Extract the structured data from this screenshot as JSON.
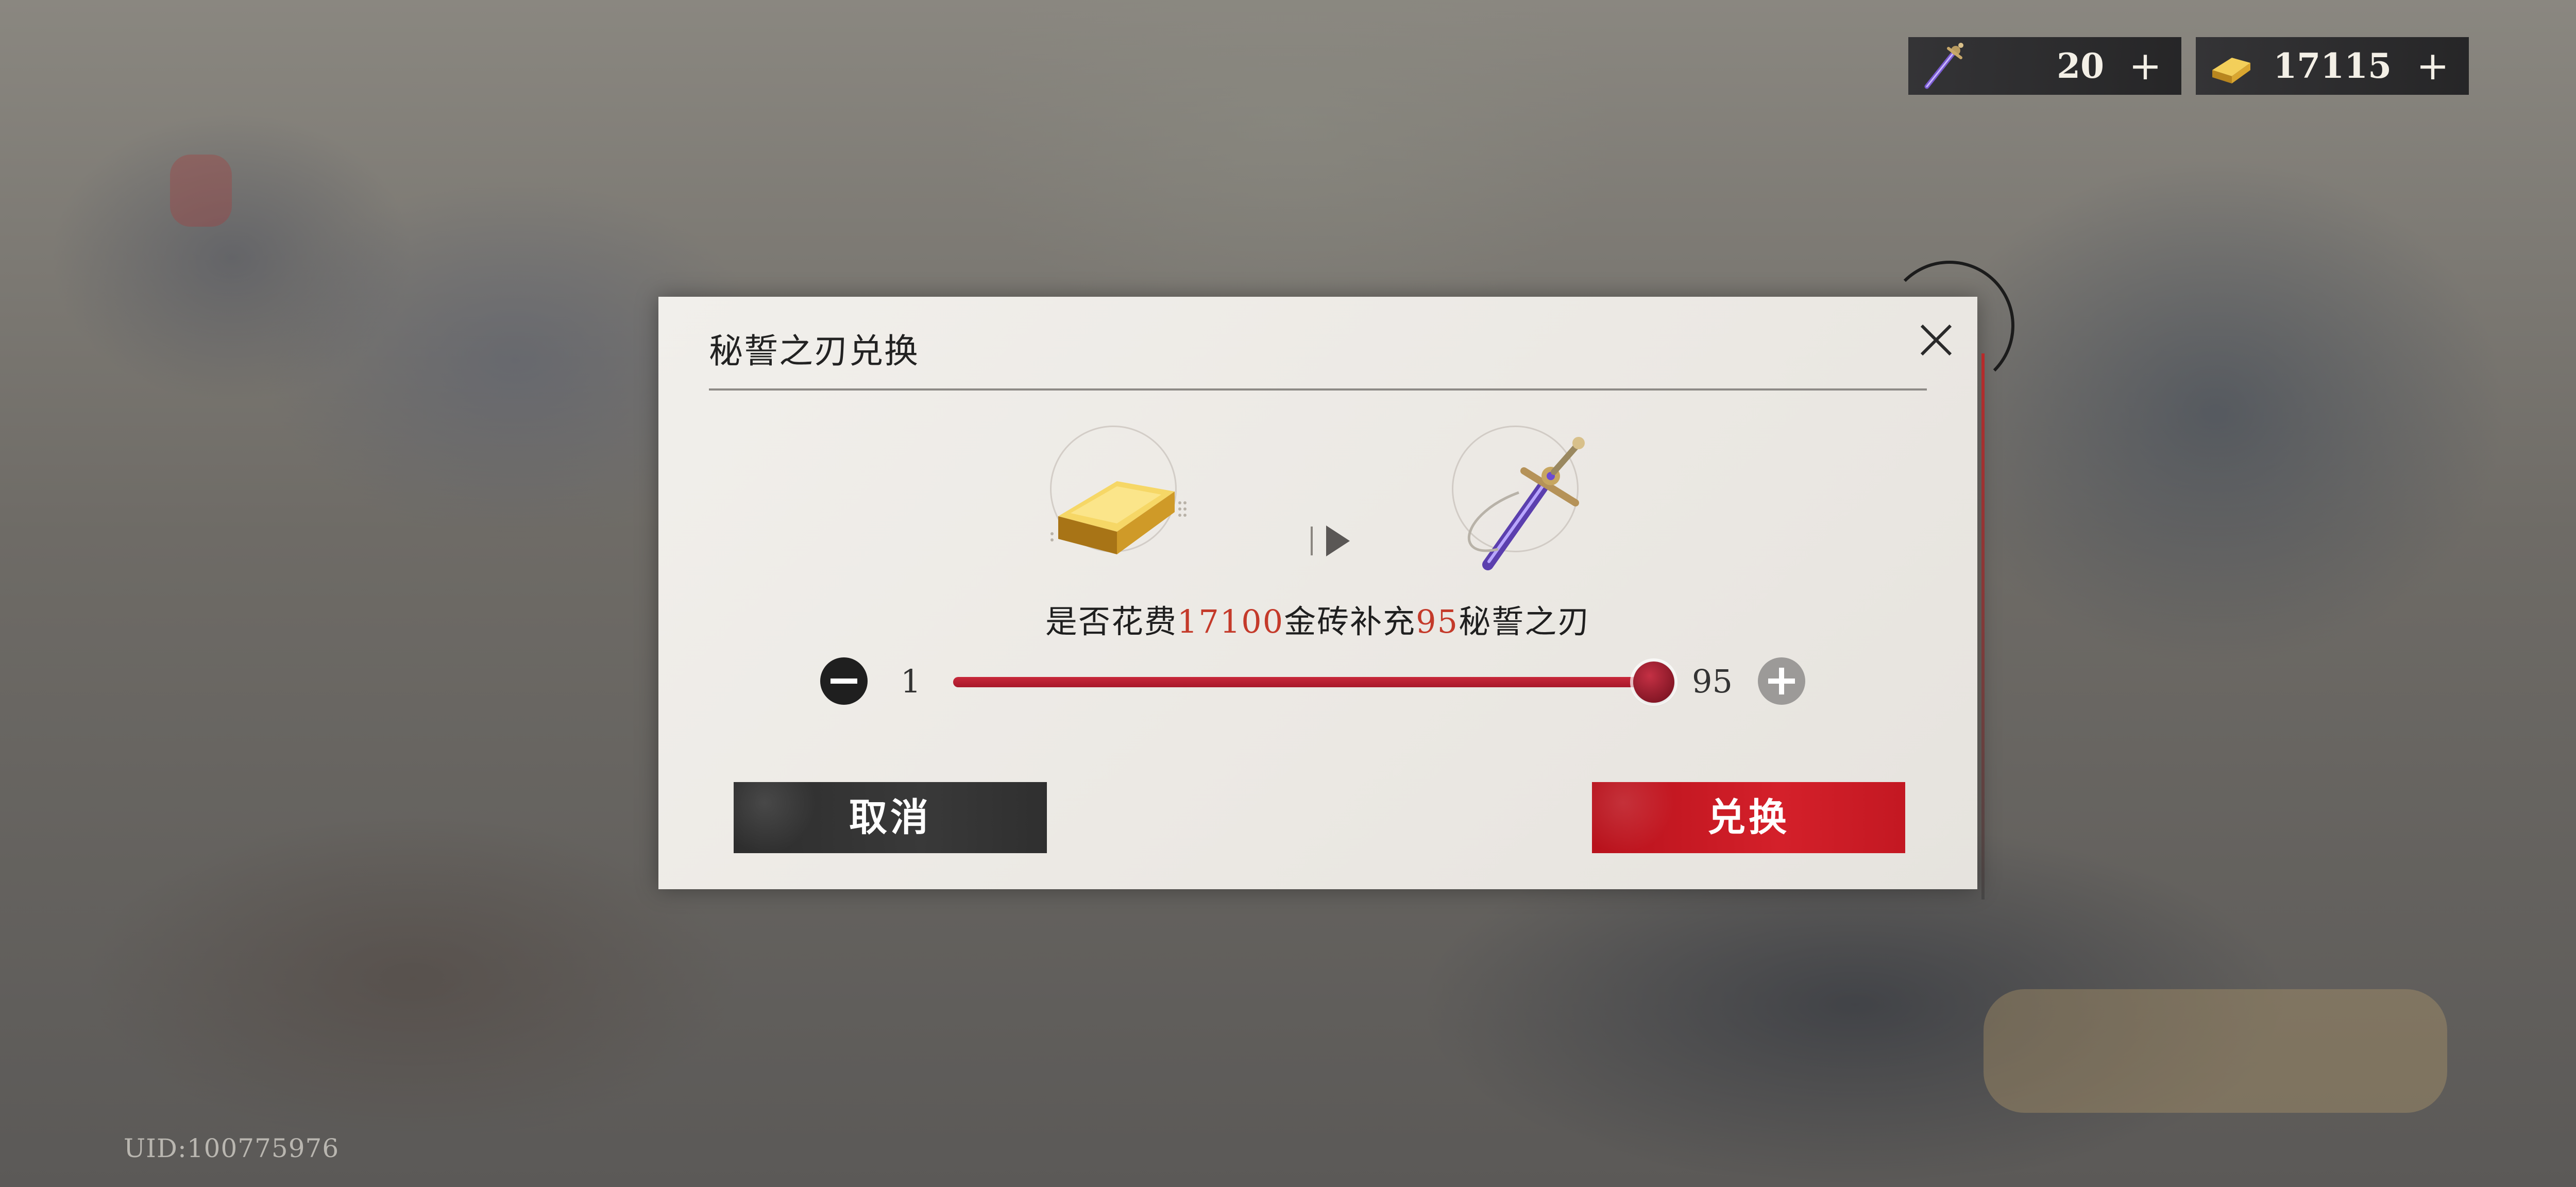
{
  "currency": {
    "blade": {
      "icon": "secret-oath-blade-icon",
      "value": "20",
      "plus": "+"
    },
    "gold": {
      "icon": "gold-brick-icon",
      "value": "17115",
      "plus": "+"
    }
  },
  "dialog": {
    "title": "秘誓之刃兑换",
    "close_icon": "close-icon",
    "from_item": "gold-brick-icon",
    "to_item": "secret-oath-blade-icon",
    "question": {
      "prefix": "是否花费",
      "cost": "17100",
      "middle": "金砖补充",
      "amount": "95",
      "suffix": "秘誓之刃"
    },
    "quantity": {
      "min_label": "1",
      "max_label": "95",
      "min": 1,
      "max": 95,
      "value": 95
    },
    "cancel_label": "取消",
    "confirm_label": "兑换"
  },
  "uid": "UID:100775976",
  "colors": {
    "accent_red": "#c8283a",
    "highlight_text": "#c43a2a",
    "cancel_bg": "#333333"
  }
}
